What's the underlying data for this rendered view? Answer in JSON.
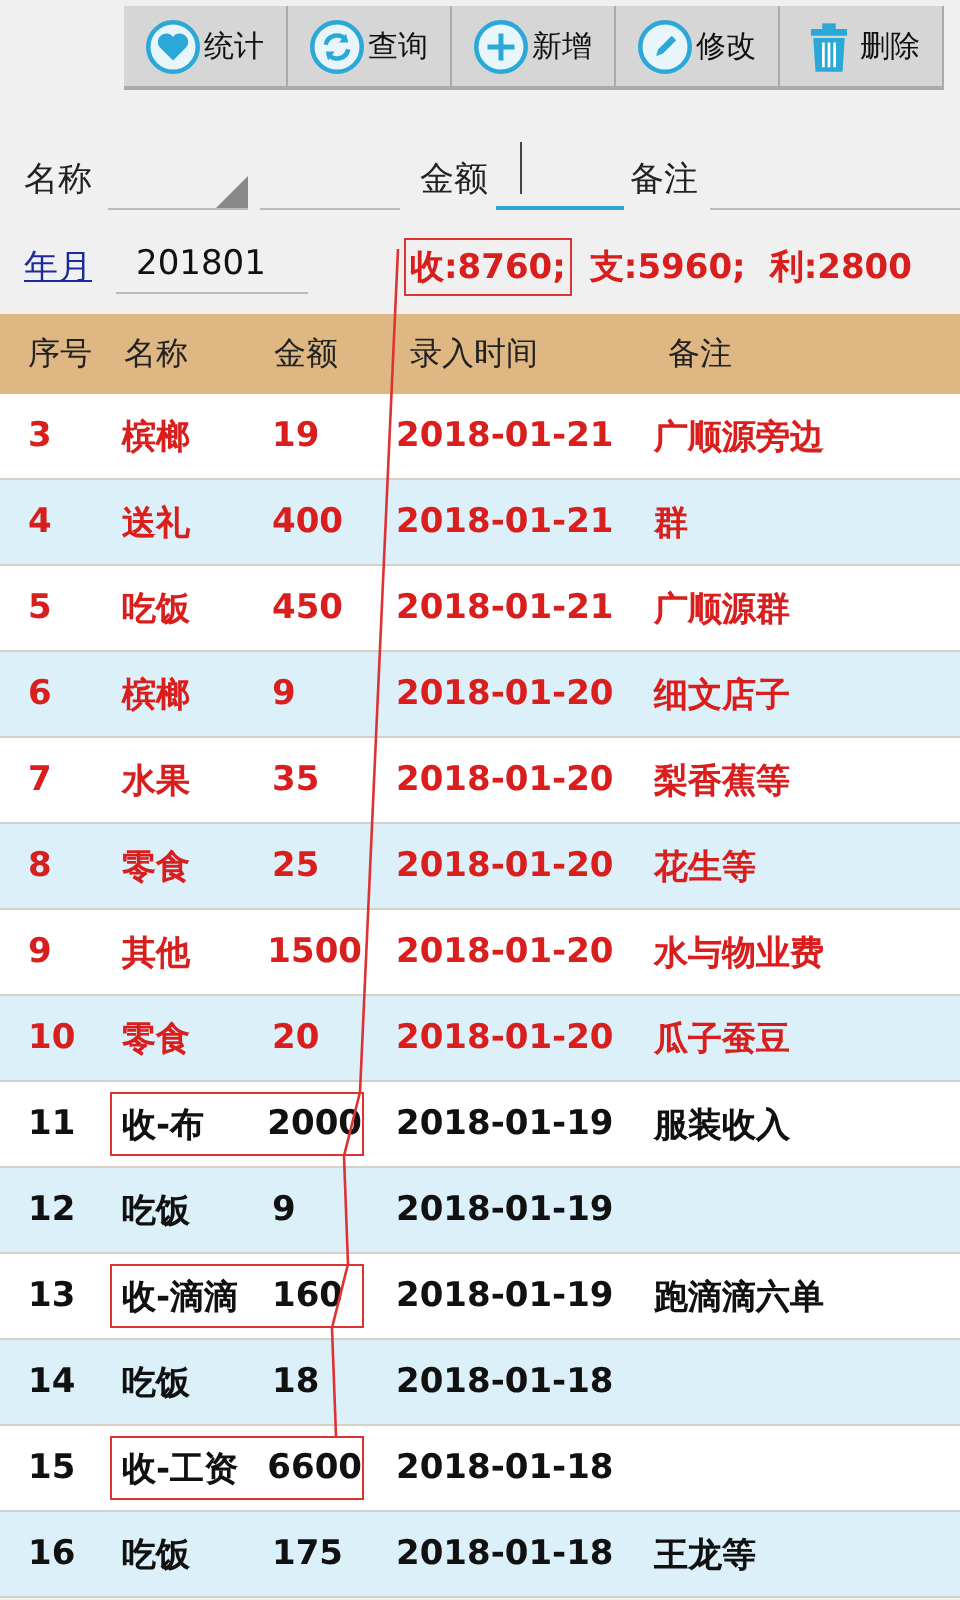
{
  "toolbar": [
    {
      "kind": "heart",
      "label": "统计"
    },
    {
      "kind": "refresh",
      "label": "查询"
    },
    {
      "kind": "plus",
      "label": "新增"
    },
    {
      "kind": "pencil",
      "label": "修改"
    },
    {
      "kind": "trash",
      "label": "删除"
    }
  ],
  "form": {
    "name_label": "名称",
    "amount_label": "金额",
    "note_label": "备注",
    "amount_focused": true
  },
  "period": {
    "link": "年月",
    "value": "201801"
  },
  "summary": [
    {
      "text": "收:8760;",
      "boxed": true
    },
    {
      "text": "支:5960;",
      "boxed": false
    },
    {
      "text": "利:2800",
      "boxed": false
    }
  ],
  "table": {
    "columns": [
      "序号",
      "名称",
      "金额",
      "录入时间",
      "备注"
    ],
    "rows": [
      {
        "no": "3",
        "name": "槟榔",
        "amount": "19",
        "date": "2018-01-21",
        "note": "广顺源旁边",
        "color": "#d91e1e",
        "boxed": false
      },
      {
        "no": "4",
        "name": "送礼",
        "amount": "400",
        "date": "2018-01-21",
        "note": "群",
        "color": "#d91e1e",
        "boxed": false
      },
      {
        "no": "5",
        "name": "吃饭",
        "amount": "450",
        "date": "2018-01-21",
        "note": "广顺源群",
        "color": "#d91e1e",
        "boxed": false
      },
      {
        "no": "6",
        "name": "槟榔",
        "amount": "9",
        "date": "2018-01-20",
        "note": "细文店子",
        "color": "#d91e1e",
        "boxed": false
      },
      {
        "no": "7",
        "name": "水果",
        "amount": "35",
        "date": "2018-01-20",
        "note": "梨香蕉等",
        "color": "#d91e1e",
        "boxed": false
      },
      {
        "no": "8",
        "name": "零食",
        "amount": "25",
        "date": "2018-01-20",
        "note": "花生等",
        "color": "#d91e1e",
        "boxed": false
      },
      {
        "no": "9",
        "name": "其他",
        "amount": "1500",
        "date": "2018-01-20",
        "note": "水与物业费",
        "color": "#d91e1e",
        "boxed": false
      },
      {
        "no": "10",
        "name": "零食",
        "amount": "20",
        "date": "2018-01-20",
        "note": "瓜子蚕豆",
        "color": "#d91e1e",
        "boxed": false
      },
      {
        "no": "11",
        "name": "收-布",
        "amount": "2000",
        "date": "2018-01-19",
        "note": "服装收入",
        "color": "#111111",
        "boxed": true
      },
      {
        "no": "12",
        "name": "吃饭",
        "amount": "9",
        "date": "2018-01-19",
        "color": "#111111",
        "boxed": false
      },
      {
        "no": "13",
        "name": "收-滴滴",
        "amount": "160",
        "date": "2018-01-19",
        "note": "跑滴滴六单",
        "color": "#111111",
        "boxed": true
      },
      {
        "no": "14",
        "name": "吃饭",
        "amount": "18",
        "date": "2018-01-18",
        "color": "#111111",
        "boxed": false
      },
      {
        "no": "15",
        "name": "收-工资",
        "amount": "6600",
        "date": "2018-01-18",
        "color": "#111111",
        "boxed": true
      },
      {
        "no": "16",
        "name": "吃饭",
        "amount": "175",
        "date": "2018-01-18",
        "note": "王龙等",
        "color": "#111111",
        "boxed": false
      }
    ]
  }
}
